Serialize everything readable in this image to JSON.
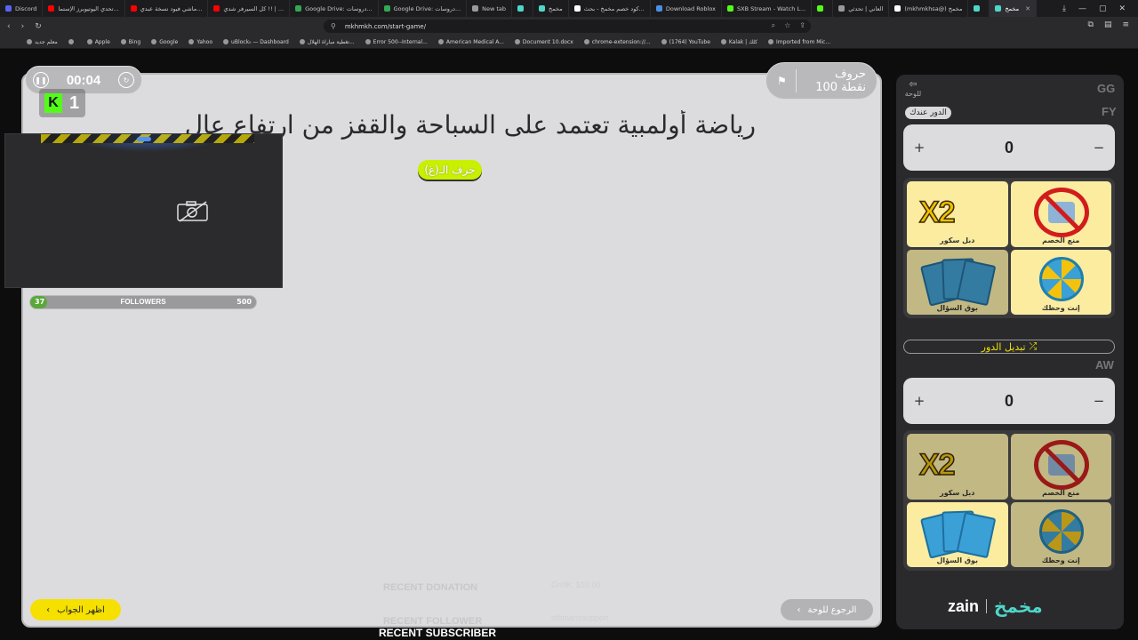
{
  "browser": {
    "tabs": [
      {
        "label": "Discord",
        "color": "#5865f2",
        "active": false
      },
      {
        "label": "تحدي اليوتيوبرز الإستما...",
        "color": "#ff0000",
        "active": false
      },
      {
        "label": "ماشي فيود نسخة عبدي...",
        "color": "#ff0000",
        "active": false
      },
      {
        "label": "كل السيرفر شدي !! | ...",
        "color": "#ff0000",
        "active": false
      },
      {
        "label": "Google Drive: دروسات...",
        "color": "#34a853",
        "active": false
      },
      {
        "label": "Google Drive: دروسات...",
        "color": "#34a853",
        "active": false
      },
      {
        "label": "New tab",
        "color": "#999999",
        "active": false
      },
      {
        "label": "",
        "color": "#4fd6c8",
        "active": false
      },
      {
        "label": "مخمخ",
        "color": "#4fd6c8",
        "active": false
      },
      {
        "label": "كود خصم مخمخ - بحث...",
        "color": "#ffffff",
        "active": false
      },
      {
        "label": "Download Roblox",
        "color": "#4a90e2",
        "active": false
      },
      {
        "label": "SXB Stream - Watch L...",
        "color": "#53fc18",
        "active": false
      },
      {
        "label": "",
        "color": "#53fc18",
        "active": false
      },
      {
        "label": "العاني | تحدثي",
        "color": "#999999",
        "active": false
      },
      {
        "label": "(mkhmkhsa@) مخمخ",
        "color": "#ffffff",
        "active": false
      },
      {
        "label": "",
        "color": "#4fd6c8",
        "active": false
      },
      {
        "label": "مخمخ",
        "color": "#4fd6c8",
        "active": true
      }
    ],
    "url": "mkhmkh.com/start-game/",
    "bookmarks": [
      "معلم جديد",
      "",
      "Apple",
      "Bing",
      "Google",
      "Yahoo",
      "uBlock₀ — Dashboard",
      "تغطية مباراة الهلال...",
      "Error 500--Internal...",
      "American Medical A...",
      "Document 10.docx",
      "chrome-extension://...",
      "(1764) YouTube",
      "Kalak | كلك",
      "Imported from Mic..."
    ]
  },
  "game": {
    "timer": "00:04",
    "category_name": "حروف",
    "category_points": "100 نقطة",
    "question": "رياضة أولمبية تعتمد على السباحة والقفز من ارتفاع عالٍ",
    "letter_hint": "حرف الـ(غ)",
    "show_answer": "اظهر الجواب",
    "back_to_board": "الرجوع للوحة"
  },
  "stream_overlay": {
    "kick_count": "1",
    "followers_label": "FOLLOWERS",
    "followers_current": "37",
    "followers_goal": "500",
    "followers_progress": 0.074,
    "recent_donation_label": "RECENT DONATION",
    "recent_donation_value": "Gn9K: $10.00",
    "recent_follower_label": "RECENT FOLLOWER",
    "recent_follower_value": "othmanssupport",
    "recent_subscriber_label": "RECENT SUBSCRIBER"
  },
  "sidebar": {
    "board_link": "للوحة",
    "team_gg": "GG",
    "team1": {
      "tag": "FY",
      "turn_badge": "الدور عندك",
      "score": "0"
    },
    "team2": {
      "tag": "AW",
      "score": "0"
    },
    "helpers": {
      "double": "دبل سكور",
      "block": "منع الخصم",
      "call": "بوق السؤال",
      "luck": "إنت وحظك"
    },
    "swap_turn": "تبديل الدور",
    "sponsor": "zain",
    "brand": "مخمخ"
  }
}
